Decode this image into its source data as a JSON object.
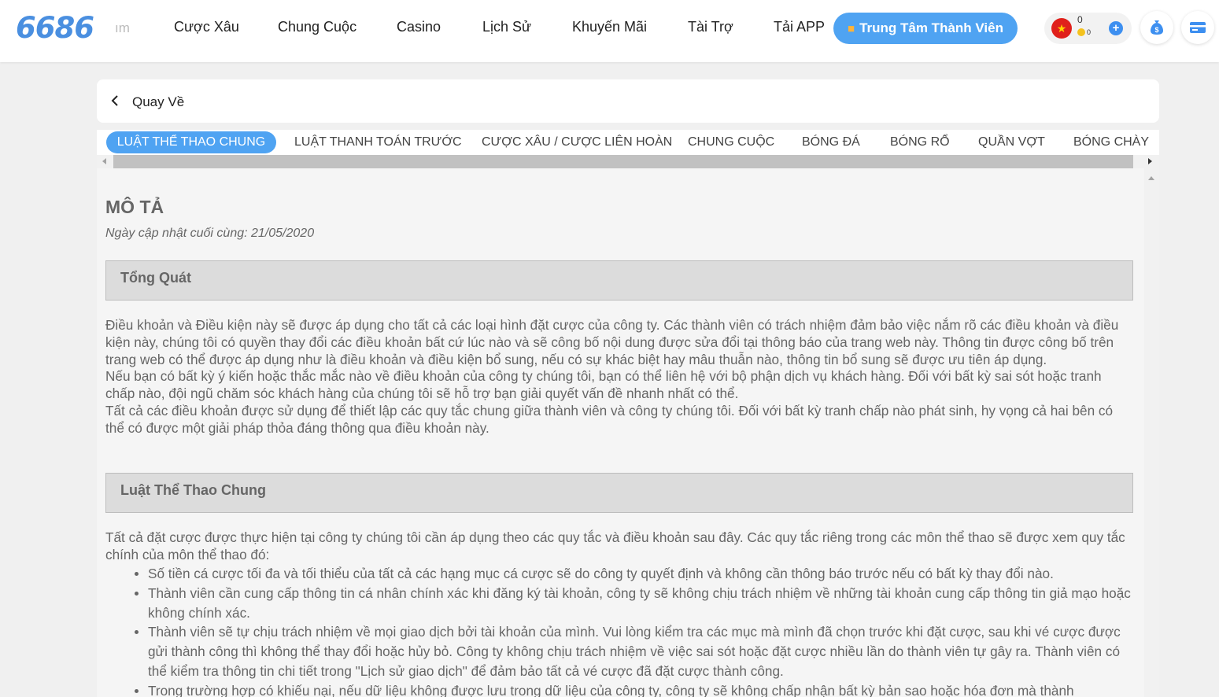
{
  "header": {
    "logo": "6686",
    "nav_partial": "ım",
    "nav": [
      "Cược Xâu",
      "Chung Cuộc",
      "Casino",
      "Lịch Sử",
      "Khuyến Mãi",
      "Tài Trợ",
      "Tải APP"
    ],
    "member_center": "Trung Tâm Thành Viên",
    "wallet": {
      "balance_main": "0",
      "balance_coin": "0"
    }
  },
  "back": {
    "label": "Quay Về"
  },
  "tabs": [
    "LUẬT THỂ THAO CHUNG",
    "LUẬT THANH TOÁN TRƯỚC",
    "CƯỢC XÂU / CƯỢC LIÊN HOÀN",
    "CHUNG CUỘC",
    "BÓNG ĐÁ",
    "BÓNG RỔ",
    "QUẦN VỢT",
    "BÓNG CHÀY"
  ],
  "doc": {
    "title": "MÔ TẢ",
    "updated": "Ngày cập nhật cuối cùng: 21/05/2020",
    "sections": [
      {
        "heading": "Tổng Quát",
        "paragraphs": [
          "Điều khoản và Điều kiện này sẽ được áp dụng cho tất cả các loại hình đặt cược của công ty. Các thành viên có trách nhiệm đảm bảo việc nắm rõ các điều khoản và điều kiện này, chúng tôi có quyền thay đổi các điều khoản bất cứ lúc nào và sẽ công bố nội dung được sửa đổi tại thông báo của trang web này. Thông tin được công bố trên trang web có thể được áp dụng như là điều khoản và điều kiện bổ sung, nếu có sự khác biệt hay mâu thuẫn nào, thông tin bổ sung sẽ được ưu tiên áp dụng.",
          "Nếu bạn có bất kỳ ý kiến hoặc thắc mắc nào về điều khoản của công ty chúng tôi, bạn có thể liên hệ với bộ phận dịch vụ khách hàng. Đối với bất kỳ sai sót hoặc tranh chấp nào, đội ngũ chăm sóc khách hàng của chúng tôi sẽ hỗ trợ bạn giải quyết vấn đề nhanh nhất có thể.",
          "Tất cả các điều khoản được sử dụng để thiết lập các quy tắc chung giữa thành viên và công ty chúng tôi. Đối với bất kỳ tranh chấp nào phát sinh, hy vọng cả hai bên có thể có được một giải pháp thỏa đáng thông qua điều khoản này."
        ]
      },
      {
        "heading": "Luật Thể Thao Chung",
        "intro": "Tất cả đặt cược được thực hiện tại công ty chúng tôi cần áp dụng theo các quy tắc và điều khoản sau đây. Các quy tắc riêng trong các môn thể thao sẽ được xem quy tắc chính của môn thể thao đó:",
        "rules": [
          "Số tiền cá cược tối đa và tối thiểu của tất cả các hạng mục cá cược sẽ do công ty quyết định và không cần thông báo trước nếu có bất kỳ thay đổi nào.",
          "Thành viên cần cung cấp thông tin cá nhân chính xác khi đăng ký tài khoản, công ty sẽ không chịu trách nhiệm về những tài khoản cung cấp thông tin giả mạo hoặc không chính xác.",
          "Thành viên sẽ tự chịu trách nhiệm về mọi giao dịch bởi tài khoản của mình. Vui lòng kiểm tra các mục mà mình đã chọn trước khi đặt cược, sau khi vé cược được gửi thành công thì không thể thay đổi hoặc hủy bỏ. Công ty không chịu trách nhiệm về việc sai sót hoặc đặt cược nhiều lần do thành viên tự gây ra. Thành viên có thể kiểm tra thông tin chi tiết trong \"Lịch sử giao dịch\" để đảm bảo tất cả vé cược đã đặt cược thành công.",
          "Trong trường hợp có khiếu nại, nếu dữ liệu không được lưu trong dữ liệu của công ty, công ty sẽ không chấp nhận bất kỳ bản sao hoặc hóa đơn mà thành"
        ]
      }
    ]
  }
}
